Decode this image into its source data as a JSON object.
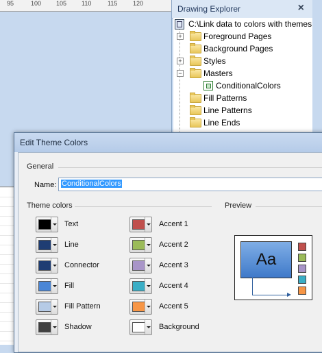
{
  "ruler": {
    "ticks": [
      "95",
      "100",
      "105",
      "110",
      "115",
      "120"
    ]
  },
  "explorer": {
    "title": "Drawing Explorer",
    "close_glyph": "×",
    "root": "C:\\Link data to colors with themes",
    "items": [
      {
        "label": "Foreground Pages"
      },
      {
        "label": "Background Pages"
      },
      {
        "label": "Styles"
      },
      {
        "label": "Masters"
      },
      {
        "label": "ConditionalColors"
      },
      {
        "label": "Fill Patterns"
      },
      {
        "label": "Line Patterns"
      },
      {
        "label": "Line Ends"
      }
    ]
  },
  "dialog": {
    "title": "Edit Theme Colors",
    "general_label": "General",
    "name_label": "Name:",
    "name_value": "ConditionalColors",
    "theme_colors_label": "Theme colors",
    "preview_label": "Preview",
    "preview_text": "Aa",
    "colors_left": [
      {
        "label": "Text",
        "color": "#000000"
      },
      {
        "label": "Line",
        "color": "#1f3d73"
      },
      {
        "label": "Connector",
        "color": "#1f3d73"
      },
      {
        "label": "Fill",
        "color": "#4a86d6"
      },
      {
        "label": "Fill Pattern",
        "color": "#b6cbe6"
      },
      {
        "label": "Shadow",
        "color": "#404040"
      }
    ],
    "colors_right": [
      {
        "label": "Accent 1",
        "color": "#c0504d"
      },
      {
        "label": "Accent 2",
        "color": "#9bbb59"
      },
      {
        "label": "Accent 3",
        "color": "#a895c8"
      },
      {
        "label": "Accent 4",
        "color": "#3aaec6"
      },
      {
        "label": "Accent 5",
        "color": "#f79646"
      },
      {
        "label": "Background",
        "color": "#ffffff"
      }
    ]
  }
}
